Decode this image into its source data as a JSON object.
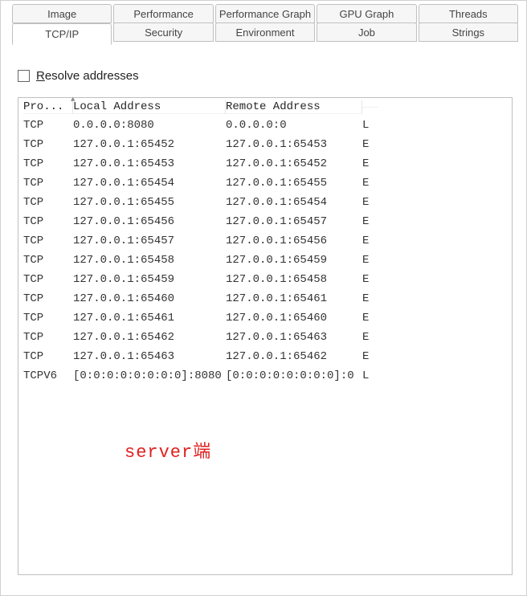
{
  "tabs": {
    "top": [
      {
        "label": "Image"
      },
      {
        "label": "Performance"
      },
      {
        "label": "Performance Graph"
      },
      {
        "label": "GPU Graph"
      },
      {
        "label": "Threads"
      }
    ],
    "bottom": [
      {
        "label": "TCP/IP",
        "active": true
      },
      {
        "label": "Security"
      },
      {
        "label": "Environment"
      },
      {
        "label": "Job"
      },
      {
        "label": "Strings"
      }
    ]
  },
  "resolve_checkbox": {
    "checked": false,
    "label_prefix": "R",
    "label_rest": "esolve addresses"
  },
  "columns": {
    "proto": "Pro...",
    "local": "Local Address",
    "remote": "Remote Address"
  },
  "rows": [
    {
      "proto": "TCP",
      "local": "0.0.0.0:8080",
      "remote": "0.0.0.0:0",
      "state": "L"
    },
    {
      "proto": "TCP",
      "local": "127.0.0.1:65452",
      "remote": "127.0.0.1:65453",
      "state": "E"
    },
    {
      "proto": "TCP",
      "local": "127.0.0.1:65453",
      "remote": "127.0.0.1:65452",
      "state": "E"
    },
    {
      "proto": "TCP",
      "local": "127.0.0.1:65454",
      "remote": "127.0.0.1:65455",
      "state": "E"
    },
    {
      "proto": "TCP",
      "local": "127.0.0.1:65455",
      "remote": "127.0.0.1:65454",
      "state": "E"
    },
    {
      "proto": "TCP",
      "local": "127.0.0.1:65456",
      "remote": "127.0.0.1:65457",
      "state": "E"
    },
    {
      "proto": "TCP",
      "local": "127.0.0.1:65457",
      "remote": "127.0.0.1:65456",
      "state": "E"
    },
    {
      "proto": "TCP",
      "local": "127.0.0.1:65458",
      "remote": "127.0.0.1:65459",
      "state": "E"
    },
    {
      "proto": "TCP",
      "local": "127.0.0.1:65459",
      "remote": "127.0.0.1:65458",
      "state": "E"
    },
    {
      "proto": "TCP",
      "local": "127.0.0.1:65460",
      "remote": "127.0.0.1:65461",
      "state": "E"
    },
    {
      "proto": "TCP",
      "local": "127.0.0.1:65461",
      "remote": "127.0.0.1:65460",
      "state": "E"
    },
    {
      "proto": "TCP",
      "local": "127.0.0.1:65462",
      "remote": "127.0.0.1:65463",
      "state": "E"
    },
    {
      "proto": "TCP",
      "local": "127.0.0.1:65463",
      "remote": "127.0.0.1:65462",
      "state": "E"
    },
    {
      "proto": "TCPV6",
      "local": "[0:0:0:0:0:0:0:0]:8080",
      "remote": "[0:0:0:0:0:0:0:0]:0",
      "state": "L"
    }
  ],
  "annotation": "server端"
}
